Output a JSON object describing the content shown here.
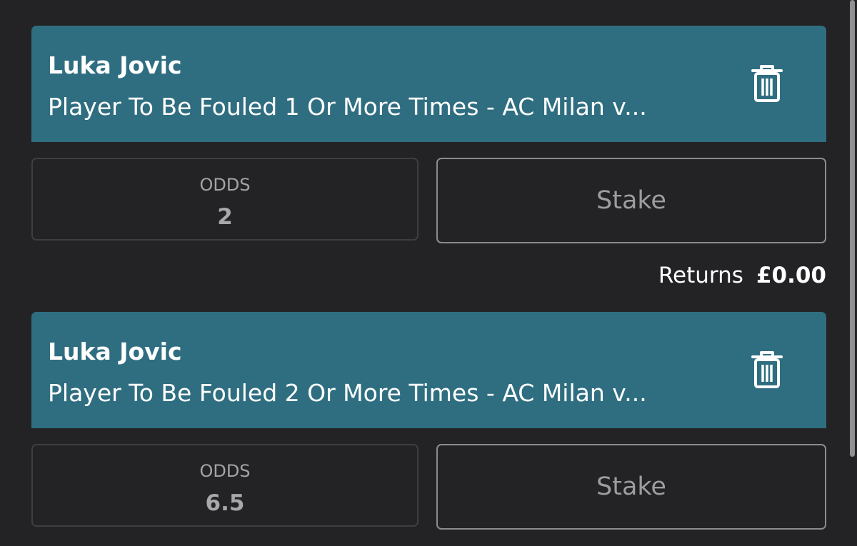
{
  "bets": [
    {
      "player": "Luka Jovic",
      "market": "Player To Be Fouled 1 Or More Times - AC Milan v...",
      "odds_label": "ODDS",
      "odds_value": "2",
      "stake_placeholder": "Stake",
      "returns_label": "Returns",
      "returns_value": "£0.00",
      "delete_icon": "trash-icon"
    },
    {
      "player": "Luka Jovic",
      "market": "Player To Be Fouled 2 Or More Times - AC Milan v...",
      "odds_label": "ODDS",
      "odds_value": "6.5",
      "stake_placeholder": "Stake",
      "delete_icon": "trash-icon"
    }
  ],
  "colors": {
    "background": "#232325",
    "header": "#2f6e80",
    "text": "#ffffff",
    "muted_text": "#a4a4a8"
  }
}
